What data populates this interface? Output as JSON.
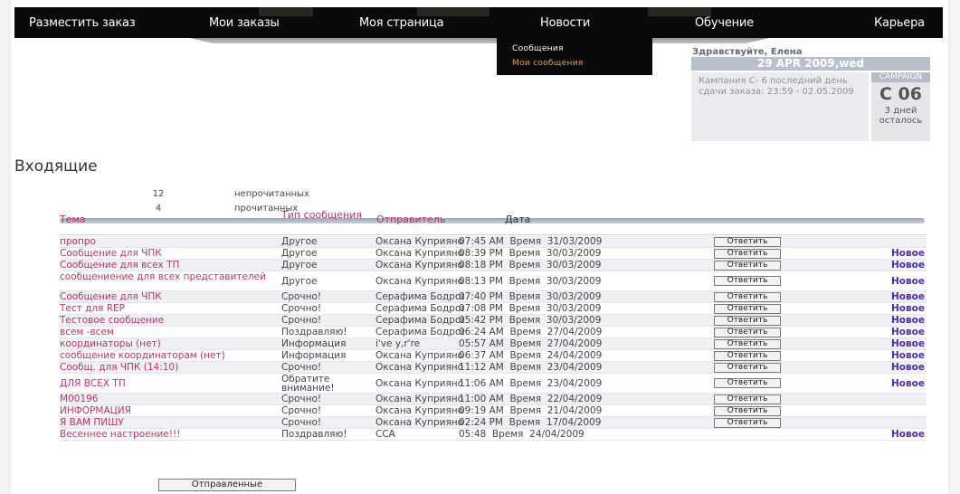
{
  "nav": {
    "items": [
      "Разместить заказ",
      "Мои заказы",
      "Моя страница",
      "Новости",
      "Обучение",
      "Карьера"
    ]
  },
  "dropdown": {
    "items": [
      {
        "label": "Сообщения",
        "color": "#ffffff"
      },
      {
        "label": "Мои сообщения",
        "color": "#f0a21e"
      }
    ]
  },
  "greeting": "Здравствуйте, Елена",
  "date": "29 APR 2009,wed",
  "campaign": {
    "text": "Кампания С- 6 последний день сдачи заказа: 23:59 - 02.05.2009",
    "label": "CAMPAIGN",
    "code": "С 06",
    "days_left": "3 дней осталось"
  },
  "page_title": "Входящие",
  "counts": [
    {
      "num": "12",
      "label": "непрочитанных"
    },
    {
      "num": "4",
      "label": "прочитанных"
    }
  ],
  "table": {
    "headers": {
      "topic": "Тема",
      "type": "Тип сообщения",
      "sender": "Отправитель",
      "date": "Дата"
    },
    "reply_label": "Ответить",
    "new_label": "Новое",
    "rows": [
      {
        "topic": "пропро",
        "type": "Другое",
        "sender": "Оксана Куприянова",
        "date": "07:45 AM  Время  31/03/2009",
        "reply": true,
        "is_new": false
      },
      {
        "topic": "Сообщение для ЧПК",
        "type": "Другое",
        "sender": "Оксана Куприянова",
        "date": "08:39 PM  Время  30/03/2009",
        "reply": true,
        "is_new": true
      },
      {
        "topic": "Сообщение для всех ТП",
        "type": "Другое",
        "sender": "Оксана Куприянова",
        "date": "08:18 PM  Время  30/03/2009",
        "reply": true,
        "is_new": true
      },
      {
        "topic": "сообщениение для всех представителей",
        "type": "Другое",
        "sender": "Оксана Куприянова",
        "date": "08:13 PM  Время  30/03/2009",
        "reply": true,
        "is_new": true
      },
      {
        "topic": "Сообщение для ЧПК",
        "type": "Срочно!",
        "sender": "Серафима Бодрова",
        "date": "07:40 PM  Время  30/03/2009",
        "reply": true,
        "is_new": true
      },
      {
        "topic": "Тест для REP",
        "type": "Срочно!",
        "sender": "Серафима Бодрова",
        "date": "07:08 PM  Время  30/03/2009",
        "reply": true,
        "is_new": true
      },
      {
        "topic": "Тестовое сообщение",
        "type": "Срочно!",
        "sender": "Серафима Бодрова",
        "date": "05:42 PM  Время  30/03/2009",
        "reply": true,
        "is_new": true
      },
      {
        "topic": "всем -всем",
        "type": "Поздравляю!",
        "sender": "Серафима Бодрова",
        "date": "06:24 AM  Время  27/04/2009",
        "reply": true,
        "is_new": true
      },
      {
        "topic": "координаторы (нет)",
        "type": "Информация",
        "sender": "i've y,r're",
        "date": "05:57 AM  Время  27/04/2009",
        "reply": true,
        "is_new": true
      },
      {
        "topic": "сообщение координаторам (нет)",
        "type": "Информация",
        "sender": "Оксана Куприянова",
        "date": "06:37 AM  Время  24/04/2009",
        "reply": true,
        "is_new": true
      },
      {
        "topic": "Сообщ. для ЧПК (14:10)",
        "type": "Срочно!",
        "sender": "Оксана Куприянова",
        "date": "11:12 AM  Время  23/04/2009",
        "reply": true,
        "is_new": true
      },
      {
        "topic": "ДЛЯ ВСЕХ ТП",
        "type": "Обратите внимание!",
        "sender": "Оксана Куприянова",
        "date": "11:06 AM  Время  23/04/2009",
        "reply": true,
        "is_new": true
      },
      {
        "topic": "М00196",
        "type": "Срочно!",
        "sender": "Оксана Куприянова",
        "date": "11:00 AM  Время  22/04/2009",
        "reply": true,
        "is_new": false
      },
      {
        "topic": "ИНФОРМАЦИЯ",
        "type": "Срочно!",
        "sender": "Оксана Куприянова",
        "date": "09:19 AM  Время  21/04/2009",
        "reply": true,
        "is_new": false
      },
      {
        "topic": "Я ВАМ ПИШУ",
        "type": "Срочно!",
        "sender": "Оксана Куприянова",
        "date": "02:24 PM  Время  17/04/2009",
        "reply": true,
        "is_new": false
      },
      {
        "topic": "Весеннее настроение!!!",
        "type": "Поздравляю!",
        "sender": "CCA",
        "date": "05:48  Время  24/04/2009",
        "reply": false,
        "is_new": true
      }
    ]
  },
  "sent_button": "Отправленные"
}
